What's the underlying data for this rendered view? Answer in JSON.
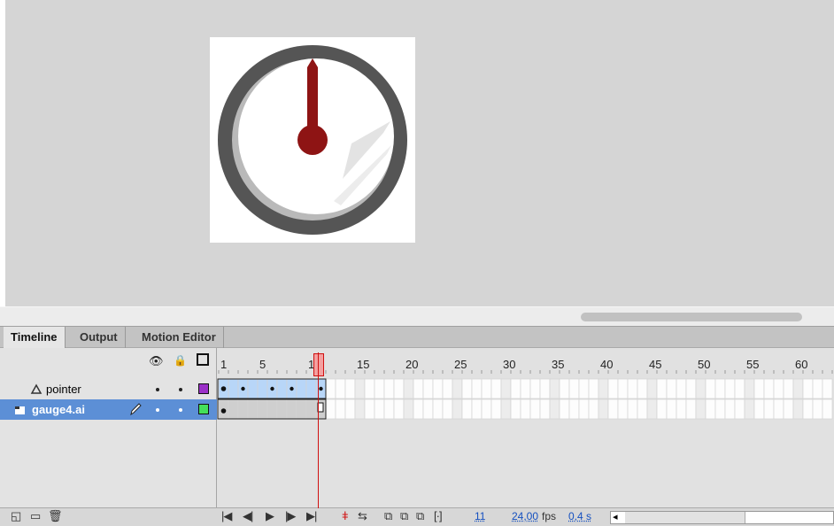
{
  "tabs": [
    {
      "label": "Timeline",
      "active": true
    },
    {
      "label": "Output",
      "active": false
    },
    {
      "label": "Motion Editor",
      "active": false
    }
  ],
  "header_icons": [
    "eye-icon",
    "lock-icon",
    "outline-icon"
  ],
  "ruler": [
    "1",
    "5",
    "10",
    "15",
    "20",
    "25",
    "30",
    "35",
    "40",
    "45",
    "50",
    "55",
    "60"
  ],
  "layers": [
    {
      "name": "pointer",
      "type": "guide-layer-icon",
      "outline_color": "#9b30c8",
      "selected": false
    },
    {
      "name": "gauge4.ai",
      "type": "layer-icon",
      "outline_color": "#44e05a",
      "selected": true
    }
  ],
  "status": {
    "current_frame": "11",
    "fps_value": "24,00",
    "fps_label": "fps",
    "time": "0,4 s"
  },
  "colors": {
    "gauge_ring": "#555555",
    "gauge_needle": "#8e1414",
    "selection": "#5c8fd6",
    "playhead": "#d01010"
  }
}
